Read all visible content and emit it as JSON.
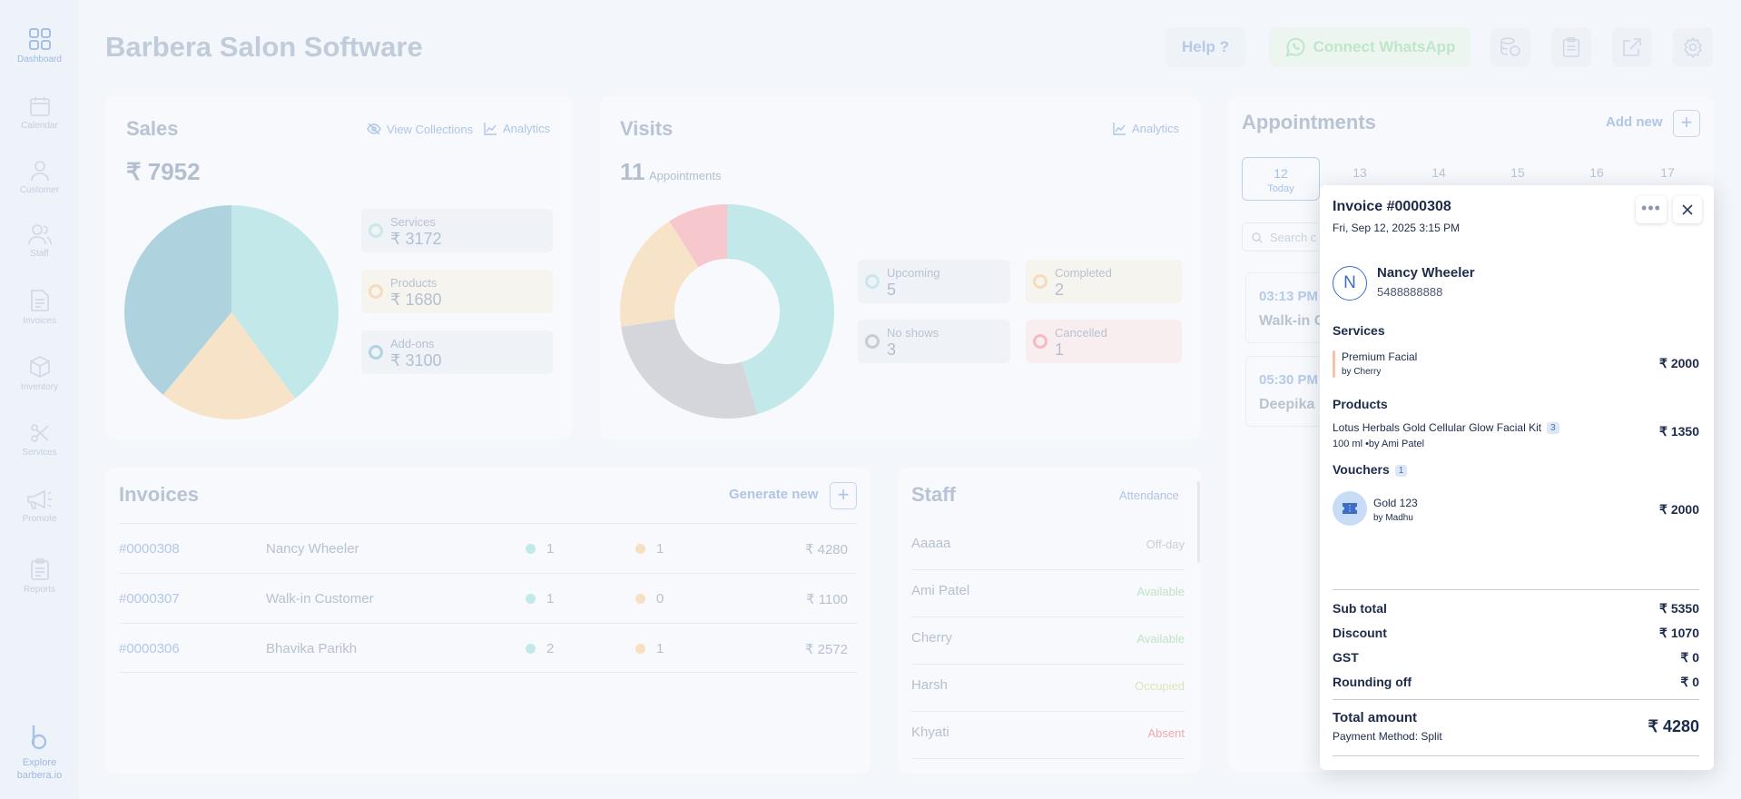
{
  "sidebar": {
    "items": [
      {
        "label": "Dashboard",
        "icon": "dashboard-icon"
      },
      {
        "label": "Calendar",
        "icon": "calendar-icon"
      },
      {
        "label": "Customer",
        "icon": "customer-icon"
      },
      {
        "label": "Staff",
        "icon": "staff-icon"
      },
      {
        "label": "Invoices",
        "icon": "invoice-icon"
      },
      {
        "label": "Inventory",
        "icon": "inventory-icon"
      },
      {
        "label": "Services",
        "icon": "scissors-icon"
      },
      {
        "label": "Promote",
        "icon": "megaphone-icon"
      },
      {
        "label": "Reports",
        "icon": "clipboard-icon"
      }
    ],
    "explore_line1": "Explore",
    "explore_line2": "barbera.io"
  },
  "header": {
    "title": "Barbera Salon Software",
    "help_label": "Help ?",
    "whatsapp_label": "Connect WhatsApp"
  },
  "sales": {
    "title": "Sales",
    "view_collections": "View Collections",
    "analytics": "Analytics",
    "total": "₹ 7952",
    "stats": [
      {
        "label": "Services",
        "value": "₹ 3172"
      },
      {
        "label": "Products",
        "value": "₹ 1680"
      },
      {
        "label": "Add-ons",
        "value": "₹ 3100"
      }
    ],
    "chart": {
      "type": "pie",
      "slices": [
        {
          "label": "Services",
          "value": 3172,
          "color": "#c3e8ea"
        },
        {
          "label": "Products",
          "value": 1680,
          "color": "#f7e4c8"
        },
        {
          "label": "Add-ons",
          "value": 3100,
          "color": "#aed3df"
        }
      ]
    }
  },
  "visits": {
    "title": "Visits",
    "analytics": "Analytics",
    "count": "11",
    "count_label": "Appointments",
    "stats": [
      {
        "label": "Upcoming",
        "value": "5"
      },
      {
        "label": "Completed",
        "value": "2"
      },
      {
        "label": "No shows",
        "value": "3"
      },
      {
        "label": "Cancelled",
        "value": "1"
      }
    ],
    "chart": {
      "type": "donut",
      "slices": [
        {
          "label": "Upcoming",
          "value": 5,
          "color": "#c3e8ea"
        },
        {
          "label": "No shows",
          "value": 3,
          "color": "#d4d6dc"
        },
        {
          "label": "Completed",
          "value": 2,
          "color": "#f7e4c8"
        },
        {
          "label": "Cancelled",
          "value": 1,
          "color": "#f6c7cc"
        }
      ]
    }
  },
  "appointments": {
    "title": "Appointments",
    "add_new": "Add new",
    "dates": [
      {
        "day": "12",
        "sub": "Today"
      },
      {
        "day": "13",
        "sub": ""
      },
      {
        "day": "14",
        "sub": ""
      },
      {
        "day": "15",
        "sub": ""
      },
      {
        "day": "16",
        "sub": ""
      },
      {
        "day": "17",
        "sub": ""
      }
    ],
    "search_placeholder": "Search c",
    "items": [
      {
        "time": "03:13 PM",
        "name": "Walk-in C"
      },
      {
        "time": "05:30 PM",
        "name": "Deepika"
      }
    ]
  },
  "invoices": {
    "title": "Invoices",
    "generate_new": "Generate new",
    "rows": [
      {
        "id": "#0000308",
        "name": "Nancy Wheeler",
        "services": "1",
        "products": "1",
        "amount": "₹ 4280"
      },
      {
        "id": "#0000307",
        "name": "Walk-in Customer",
        "services": "1",
        "products": "0",
        "amount": "₹ 1100"
      },
      {
        "id": "#0000306",
        "name": "Bhavika Parikh",
        "services": "2",
        "products": "1",
        "amount": "₹ 2572"
      }
    ]
  },
  "staff": {
    "title": "Staff",
    "attendance": "Attendance",
    "rows": [
      {
        "name": "Aaaaa",
        "status": "Off-day",
        "color": "#c7cfdb"
      },
      {
        "name": "Ami Patel",
        "status": "Available",
        "color": "#bfe3c6"
      },
      {
        "name": "Cherry",
        "status": "Available",
        "color": "#bfe3c6"
      },
      {
        "name": "Harsh",
        "status": "Occupied",
        "color": "#dfe3b7"
      },
      {
        "name": "Khyati",
        "status": "Absent",
        "color": "#f2a9ad"
      }
    ]
  },
  "invoice_panel": {
    "title": "Invoice #0000308",
    "datetime": "Fri, Sep 12, 2025 3:15 PM",
    "customer_initial": "N",
    "customer_name": "Nancy Wheeler",
    "customer_phone": "5488888888",
    "services_heading": "Services",
    "service_name": "Premium Facial",
    "service_by": "by Cherry",
    "service_amount": "₹ 2000",
    "products_heading": "Products",
    "product_name": "Lotus Herbals Gold Cellular Glow Facial Kit",
    "product_qty": "3",
    "product_meta": "100 ml •by Ami Patel",
    "product_amount": "₹ 1350",
    "vouchers_heading": "Vouchers",
    "vouchers_count": "1",
    "voucher_name": "Gold 123",
    "voucher_by": "by Madhu",
    "voucher_amount": "₹ 2000",
    "subtotal_label": "Sub total",
    "subtotal": "₹ 5350",
    "discount_label": "Discount",
    "discount": "₹ 1070",
    "gst_label": "GST",
    "gst": "₹ 0",
    "rounding_label": "Rounding off",
    "rounding": "₹ 0",
    "total_label": "Total amount",
    "total": "₹ 4280",
    "payment_method": "Payment Method: Split"
  }
}
